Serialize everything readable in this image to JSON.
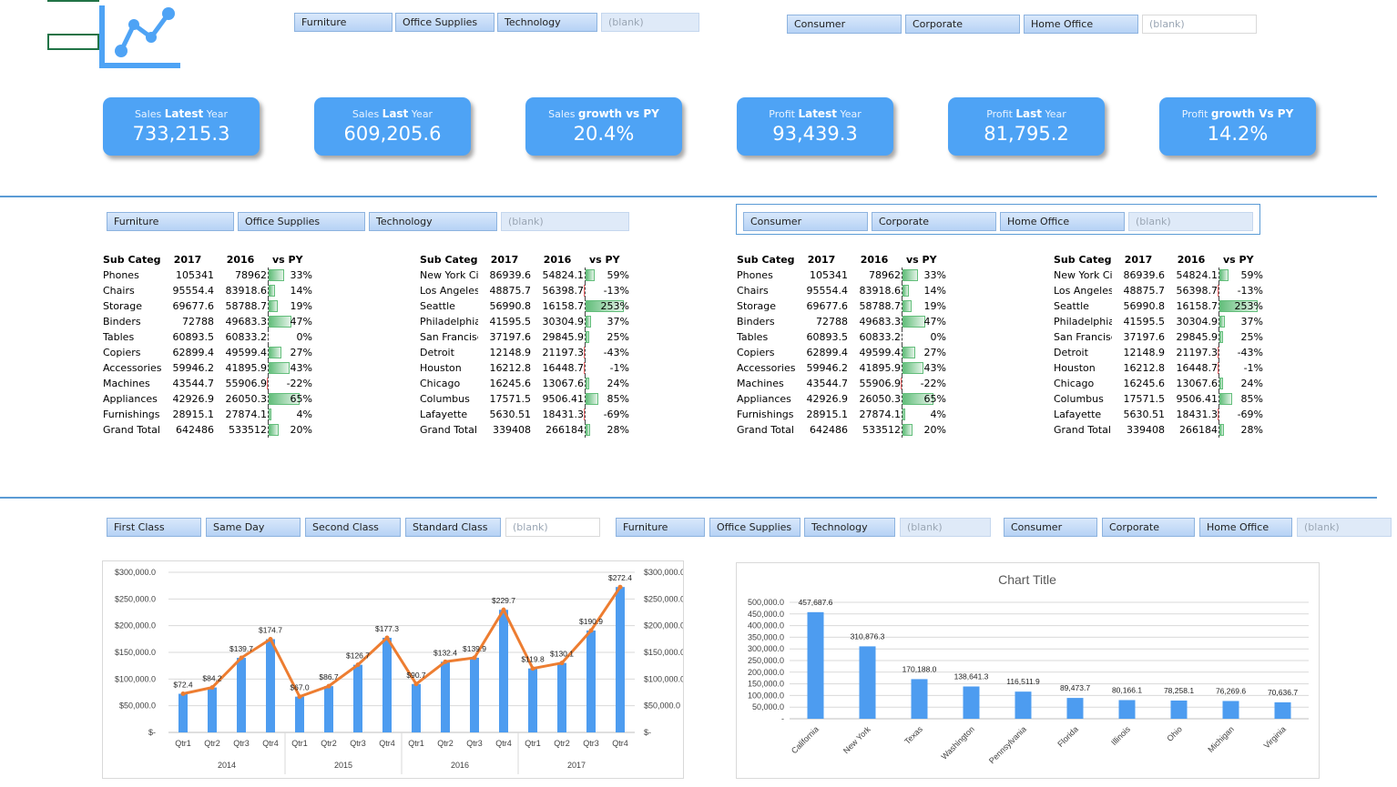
{
  "top": {
    "category_slicer": [
      "Furniture",
      "Office Supplies",
      "Technology",
      "(blank)"
    ],
    "segment_slicer": [
      "Consumer",
      "Corporate",
      "Home Office",
      "(blank)"
    ]
  },
  "kpis": [
    {
      "pre": "Sales ",
      "bold": "Latest",
      "post": " Year",
      "value": "733,215.3"
    },
    {
      "pre": "Sales ",
      "bold": "Last",
      "post": " Year",
      "value": "609,205.6"
    },
    {
      "pre": "Sales ",
      "bold": "growth vs PY",
      "post": "",
      "value": "20.4%"
    },
    {
      "pre": "Profit ",
      "bold": "Latest",
      "post": " Year",
      "value": "93,439.3"
    },
    {
      "pre": "Profit ",
      "bold": "Last",
      "post": " Year",
      "value": "81,795.2"
    },
    {
      "pre": "Profit ",
      "bold": "growth Vs PY",
      "post": "",
      "value": "14.2%"
    }
  ],
  "mid": {
    "category_slicer": [
      "Furniture",
      "Office Supplies",
      "Technology",
      "(blank)"
    ],
    "segment_slicer": [
      "Consumer",
      "Corporate",
      "Home Office",
      "(blank)"
    ]
  },
  "pivot_headers": [
    "Sub Categ",
    "2017",
    "2016",
    "vs PY"
  ],
  "pivot_subcat": [
    {
      "name": "Phones",
      "y2017": "105341",
      "y2016": "78962",
      "pct": "33%",
      "v": 33
    },
    {
      "name": "Chairs",
      "y2017": "95554.4",
      "y2016": "83918.6",
      "pct": "14%",
      "v": 14
    },
    {
      "name": "Storage",
      "y2017": "69677.6",
      "y2016": "58788.7",
      "pct": "19%",
      "v": 19
    },
    {
      "name": "Binders",
      "y2017": "72788",
      "y2016": "49683.3",
      "pct": "47%",
      "v": 47
    },
    {
      "name": "Tables",
      "y2017": "60893.5",
      "y2016": "60833.2",
      "pct": "0%",
      "v": 0
    },
    {
      "name": "Copiers",
      "y2017": "62899.4",
      "y2016": "49599.4",
      "pct": "27%",
      "v": 27
    },
    {
      "name": "Accessories",
      "y2017": "59946.2",
      "y2016": "41895.9",
      "pct": "43%",
      "v": 43
    },
    {
      "name": "Machines",
      "y2017": "43544.7",
      "y2016": "55906.9",
      "pct": "-22%",
      "v": -22
    },
    {
      "name": "Appliances",
      "y2017": "42926.9",
      "y2016": "26050.3",
      "pct": "65%",
      "v": 65
    },
    {
      "name": "Furnishings",
      "y2017": "28915.1",
      "y2016": "27874.1",
      "pct": "4%",
      "v": 4
    },
    {
      "name": "Grand Total",
      "y2017": "642486",
      "y2016": "533512",
      "pct": "20%",
      "v": 20
    }
  ],
  "pivot_city": [
    {
      "name": "New York City",
      "y2017": "86939.6",
      "y2016": "54824.1",
      "pct": "59%",
      "v": 59
    },
    {
      "name": "Los Angeles",
      "y2017": "48875.7",
      "y2016": "56398.7",
      "pct": "-13%",
      "v": -13
    },
    {
      "name": "Seattle",
      "y2017": "56990.8",
      "y2016": "16158.7",
      "pct": "253%",
      "v": 253
    },
    {
      "name": "Philadelphia",
      "y2017": "41595.5",
      "y2016": "30304.9",
      "pct": "37%",
      "v": 37
    },
    {
      "name": "San Francisco",
      "y2017": "37197.6",
      "y2016": "29845.9",
      "pct": "25%",
      "v": 25
    },
    {
      "name": "Detroit",
      "y2017": "12148.9",
      "y2016": "21197.3",
      "pct": "-43%",
      "v": -43
    },
    {
      "name": "Houston",
      "y2017": "16212.8",
      "y2016": "16448.7",
      "pct": "-1%",
      "v": -1
    },
    {
      "name": "Chicago",
      "y2017": "16245.6",
      "y2016": "13067.6",
      "pct": "24%",
      "v": 24
    },
    {
      "name": "Columbus",
      "y2017": "17571.5",
      "y2016": "9506.41",
      "pct": "85%",
      "v": 85
    },
    {
      "name": "Lafayette",
      "y2017": "5630.51",
      "y2016": "18431.3",
      "pct": "-69%",
      "v": -69
    },
    {
      "name": "Grand Total",
      "y2017": "339408",
      "y2016": "266184",
      "pct": "28%",
      "v": 28
    }
  ],
  "bottom": {
    "shipmode_slicer": [
      "First Class",
      "Same Day",
      "Second Class",
      "Standard Class",
      "(blank)"
    ],
    "category_slicer": [
      "Furniture",
      "Office Supplies",
      "Technology",
      "(blank)"
    ],
    "segment_slicer": [
      "Consumer",
      "Corporate",
      "Home Office",
      "(blank)"
    ]
  },
  "colors": {
    "accent": "#4ea3f5",
    "bar": "#4d9cf0",
    "line": "#ed7d31",
    "pos": "#63be7b",
    "neg": "#f8696b"
  },
  "chart_data": [
    {
      "type": "bar",
      "combo_line": true,
      "years": [
        "2014",
        "2015",
        "2016",
        "2017"
      ],
      "categories": [
        "Qtr1",
        "Qtr2",
        "Qtr3",
        "Qtr4",
        "Qtr1",
        "Qtr2",
        "Qtr3",
        "Qtr4",
        "Qtr1",
        "Qtr2",
        "Qtr3",
        "Qtr4",
        "Qtr1",
        "Qtr2",
        "Qtr3",
        "Qtr4"
      ],
      "values": [
        72.4,
        84.2,
        139.7,
        174.7,
        67.0,
        86.7,
        126.7,
        177.3,
        90.7,
        132.4,
        139.9,
        229.7,
        119.8,
        130.1,
        190.9,
        272.4
      ],
      "data_labels": [
        "$72.4",
        "$84.2",
        "$139.7",
        "$174.7",
        "$67.0",
        "$86.7",
        "$126.7",
        "$177.3",
        "$90.7",
        "$132.4",
        "$139.9",
        "$229.7",
        "$119.8",
        "$130.1",
        "$190.9",
        "$272.4"
      ],
      "yticks": [
        "$300,000.0",
        "$250,000.0",
        "$200,000.0",
        "$150,000.0",
        "$100,000.0",
        "$50,000.0",
        "$-"
      ],
      "ylim": [
        0,
        300000
      ],
      "grid": true
    },
    {
      "type": "bar",
      "title": "Chart Title",
      "categories": [
        "California",
        "New York",
        "Texas",
        "Washington",
        "Pennsylvania",
        "Florida",
        "Illinois",
        "Ohio",
        "Michigan",
        "Virginia"
      ],
      "values": [
        457687.6,
        310876.3,
        170188.0,
        138641.3,
        116511.9,
        89473.7,
        80166.1,
        78258.1,
        76269.6,
        70636.7
      ],
      "data_labels": [
        "457,687.6",
        "310,876.3",
        "170,188.0",
        "138,641.3",
        "116,511.9",
        "89,473.7",
        "80,166.1",
        "78,258.1",
        "76,269.6",
        "70,636.7"
      ],
      "yticks": [
        "500,000.0",
        "450,000.0",
        "400,000.0",
        "350,000.0",
        "300,000.0",
        "250,000.0",
        "200,000.0",
        "150,000.0",
        "100,000.0",
        "50,000.0",
        "-"
      ],
      "ylim": [
        0,
        500000
      ],
      "grid": true
    }
  ]
}
